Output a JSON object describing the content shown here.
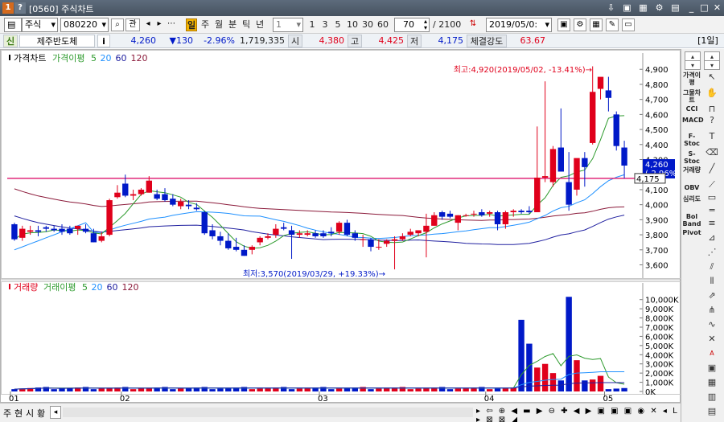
{
  "window": {
    "title": "[0560] 주식차트",
    "buttons": [
      "?",
      "1"
    ]
  },
  "toolbar": {
    "market": "주식",
    "code": "080220",
    "search_icon": "search-icon",
    "related_label": "관",
    "periods": [
      "일",
      "주",
      "월",
      "분",
      "틱",
      "년"
    ],
    "period_value": "1",
    "minute_presets": [
      "1",
      "3",
      "5",
      "10",
      "30",
      "60"
    ],
    "count": "70",
    "count_total": "/ 2100",
    "date": "2019/05/0:",
    "daily_label": "[1일]"
  },
  "info": {
    "tag": "신",
    "name": "제주반도체",
    "info_icon": "i",
    "price": "4,260",
    "change": "▼130",
    "change_pct": "-2.96%",
    "volume": "1,719,335",
    "open_label": "시",
    "open": "4,380",
    "high_label": "고",
    "high": "4,425",
    "low_label": "저",
    "low": "4,175",
    "strength_label": "체결강도",
    "strength": "63.67"
  },
  "price_panel": {
    "legend": [
      {
        "text": "가격차트",
        "color": "#000000"
      },
      {
        "text": "가격이평",
        "color": "#2e9b2e"
      },
      {
        "text": "5",
        "color": "#2e9b2e"
      },
      {
        "text": "20",
        "color": "#1e90ff"
      },
      {
        "text": "60",
        "color": "#2020a0"
      },
      {
        "text": "120",
        "color": "#8b1a3a"
      }
    ],
    "max_annotation": "최고:4,920(2019/05/02, -13.41%)→",
    "min_annotation": "최저:3,570(2019/03/29, +19.33%)→",
    "y_ticks": [
      "4,900",
      "4,800",
      "4,700",
      "4,600",
      "4,500",
      "4,400",
      "4,300",
      "4,200",
      "4,100",
      "4,000",
      "3,900",
      "3,800",
      "3,700",
      "3,600"
    ],
    "current_price_label": "4,260",
    "current_pct_label": "(-2.96%)",
    "low_line_label": "4,175"
  },
  "volume_panel": {
    "legend": [
      {
        "text": "거래량",
        "color": "#e0001b"
      },
      {
        "text": "거래이평",
        "color": "#2e9b2e"
      },
      {
        "text": "5",
        "color": "#2e9b2e"
      },
      {
        "text": "20",
        "color": "#1e90ff"
      },
      {
        "text": "60",
        "color": "#2020a0"
      },
      {
        "text": "120",
        "color": "#8b1a3a"
      }
    ],
    "y_ticks": [
      "10,000K",
      "9,000K",
      "8,000K",
      "7,000K",
      "6,000K",
      "5,000K",
      "4,000K",
      "3,000K",
      "2,000K",
      "1,000K",
      "0K"
    ]
  },
  "x_axis": {
    "labels": [
      "01",
      "02",
      "03",
      "04",
      "05"
    ]
  },
  "bottom": {
    "tabs": [
      "주",
      "현",
      "시",
      "황"
    ]
  },
  "sidebar": {
    "labels": [
      "가격이평",
      "그물차트",
      "CCI",
      "MACD",
      "F-Stoc",
      "S-Stoc",
      "거래량",
      "OBV",
      "심리도",
      "Bol Band",
      "Pivot"
    ]
  },
  "colors": {
    "up": "#e0001b",
    "down": "#0019c8",
    "hline": "#e0287a"
  },
  "chart_data": {
    "type": "candlestick",
    "candles": [
      {
        "o": 3870,
        "h": 3880,
        "l": 3760,
        "c": 3770
      },
      {
        "o": 3780,
        "h": 3860,
        "l": 3760,
        "c": 3840
      },
      {
        "o": 3820,
        "h": 3860,
        "l": 3800,
        "c": 3830
      },
      {
        "o": 3830,
        "h": 3860,
        "l": 3790,
        "c": 3820
      },
      {
        "o": 3850,
        "h": 3860,
        "l": 3820,
        "c": 3840
      },
      {
        "o": 3840,
        "h": 3860,
        "l": 3820,
        "c": 3830
      },
      {
        "o": 3840,
        "h": 3870,
        "l": 3800,
        "c": 3820
      },
      {
        "o": 3840,
        "h": 3860,
        "l": 3800,
        "c": 3810
      },
      {
        "o": 3840,
        "h": 3860,
        "l": 3800,
        "c": 3860
      },
      {
        "o": 3840,
        "h": 3870,
        "l": 3810,
        "c": 3820
      },
      {
        "o": 3810,
        "h": 3840,
        "l": 3750,
        "c": 3750
      },
      {
        "o": 3760,
        "h": 3820,
        "l": 3750,
        "c": 3790
      },
      {
        "o": 3800,
        "h": 4040,
        "l": 3790,
        "c": 4030
      },
      {
        "o": 4050,
        "h": 4130,
        "l": 4040,
        "c": 4080
      },
      {
        "o": 4140,
        "h": 4200,
        "l": 4050,
        "c": 4060
      },
      {
        "o": 4060,
        "h": 4100,
        "l": 4030,
        "c": 4070
      },
      {
        "o": 4070,
        "h": 4110,
        "l": 4060,
        "c": 4100
      },
      {
        "o": 4080,
        "h": 4190,
        "l": 4080,
        "c": 4160
      },
      {
        "o": 4070,
        "h": 4100,
        "l": 4030,
        "c": 4040
      },
      {
        "o": 4070,
        "h": 4110,
        "l": 4020,
        "c": 4030
      },
      {
        "o": 4040,
        "h": 4070,
        "l": 3990,
        "c": 4000
      },
      {
        "o": 3990,
        "h": 4040,
        "l": 3970,
        "c": 4020
      },
      {
        "o": 4000,
        "h": 4030,
        "l": 3970,
        "c": 3990
      },
      {
        "o": 3980,
        "h": 4010,
        "l": 3960,
        "c": 3970
      },
      {
        "o": 3950,
        "h": 3960,
        "l": 3800,
        "c": 3810
      },
      {
        "o": 3830,
        "h": 3870,
        "l": 3770,
        "c": 3790
      },
      {
        "o": 3790,
        "h": 3820,
        "l": 3730,
        "c": 3760
      },
      {
        "o": 3760,
        "h": 3810,
        "l": 3700,
        "c": 3710
      },
      {
        "o": 3720,
        "h": 3780,
        "l": 3690,
        "c": 3700
      },
      {
        "o": 3700,
        "h": 3730,
        "l": 3660,
        "c": 3660
      },
      {
        "o": 3700,
        "h": 3730,
        "l": 3670,
        "c": 3720
      },
      {
        "o": 3750,
        "h": 3790,
        "l": 3730,
        "c": 3780
      },
      {
        "o": 3780,
        "h": 3810,
        "l": 3770,
        "c": 3790
      },
      {
        "o": 3800,
        "h": 3870,
        "l": 3780,
        "c": 3840
      },
      {
        "o": 3850,
        "h": 3880,
        "l": 3830,
        "c": 3840
      },
      {
        "o": 3830,
        "h": 3860,
        "l": 3640,
        "c": 3800
      },
      {
        "o": 3800,
        "h": 3830,
        "l": 3780,
        "c": 3810
      },
      {
        "o": 3800,
        "h": 3830,
        "l": 3790,
        "c": 3810
      },
      {
        "o": 3810,
        "h": 3830,
        "l": 3780,
        "c": 3790
      },
      {
        "o": 3810,
        "h": 3830,
        "l": 3780,
        "c": 3790
      },
      {
        "o": 3820,
        "h": 3850,
        "l": 3790,
        "c": 3810
      },
      {
        "o": 3820,
        "h": 3890,
        "l": 3800,
        "c": 3880
      },
      {
        "o": 3880,
        "h": 3900,
        "l": 3790,
        "c": 3800
      },
      {
        "o": 3810,
        "h": 3830,
        "l": 3760,
        "c": 3780
      },
      {
        "o": 3770,
        "h": 3800,
        "l": 3720,
        "c": 3770
      },
      {
        "o": 3770,
        "h": 3780,
        "l": 3690,
        "c": 3720
      },
      {
        "o": 3720,
        "h": 3770,
        "l": 3700,
        "c": 3720
      },
      {
        "o": 3740,
        "h": 3770,
        "l": 3720,
        "c": 3760
      },
      {
        "o": 3760,
        "h": 3790,
        "l": 3570,
        "c": 3770
      },
      {
        "o": 3770,
        "h": 3810,
        "l": 3760,
        "c": 3790
      },
      {
        "o": 3800,
        "h": 3840,
        "l": 3790,
        "c": 3820
      },
      {
        "o": 3810,
        "h": 3830,
        "l": 3790,
        "c": 3830
      },
      {
        "o": 3820,
        "h": 3940,
        "l": 3650,
        "c": 3860
      },
      {
        "o": 3860,
        "h": 3950,
        "l": 3860,
        "c": 3930
      },
      {
        "o": 3950,
        "h": 3960,
        "l": 3900,
        "c": 3920
      },
      {
        "o": 3940,
        "h": 3960,
        "l": 3910,
        "c": 3920
      },
      {
        "o": 3880,
        "h": 3930,
        "l": 3830,
        "c": 3930
      },
      {
        "o": 3930,
        "h": 3940,
        "l": 3920,
        "c": 3930
      },
      {
        "o": 3940,
        "h": 3960,
        "l": 3920,
        "c": 3940
      },
      {
        "o": 3950,
        "h": 3970,
        "l": 3920,
        "c": 3930
      },
      {
        "o": 3940,
        "h": 3960,
        "l": 3920,
        "c": 3950
      },
      {
        "o": 3950,
        "h": 3960,
        "l": 3830,
        "c": 3870
      },
      {
        "o": 3870,
        "h": 3960,
        "l": 3840,
        "c": 3950
      },
      {
        "o": 3950,
        "h": 3970,
        "l": 3920,
        "c": 3960
      },
      {
        "o": 3960,
        "h": 3970,
        "l": 3940,
        "c": 3950
      },
      {
        "o": 3960,
        "h": 3990,
        "l": 3940,
        "c": 3950
      },
      {
        "o": 3950,
        "h": 4520,
        "l": 3950,
        "c": 4180
      },
      {
        "o": 4180,
        "h": 4820,
        "l": 4150,
        "c": 4190
      },
      {
        "o": 4150,
        "h": 4390,
        "l": 4120,
        "c": 4370
      },
      {
        "o": 4380,
        "h": 4640,
        "l": 4300,
        "c": 4220
      },
      {
        "o": 4150,
        "h": 4350,
        "l": 3960,
        "c": 4000
      },
      {
        "o": 4100,
        "h": 4290,
        "l": 4060,
        "c": 4310
      },
      {
        "o": 4310,
        "h": 4350,
        "l": 4120,
        "c": 4250
      },
      {
        "o": 4410,
        "h": 4920,
        "l": 4400,
        "c": 4750
      },
      {
        "o": 4770,
        "h": 4840,
        "l": 4700,
        "c": 4850
      },
      {
        "o": 4760,
        "h": 4850,
        "l": 4620,
        "c": 4710
      },
      {
        "o": 4600,
        "h": 4620,
        "l": 4360,
        "c": 4390
      },
      {
        "o": 4380,
        "h": 4425,
        "l": 4175,
        "c": 4260
      }
    ]
  }
}
